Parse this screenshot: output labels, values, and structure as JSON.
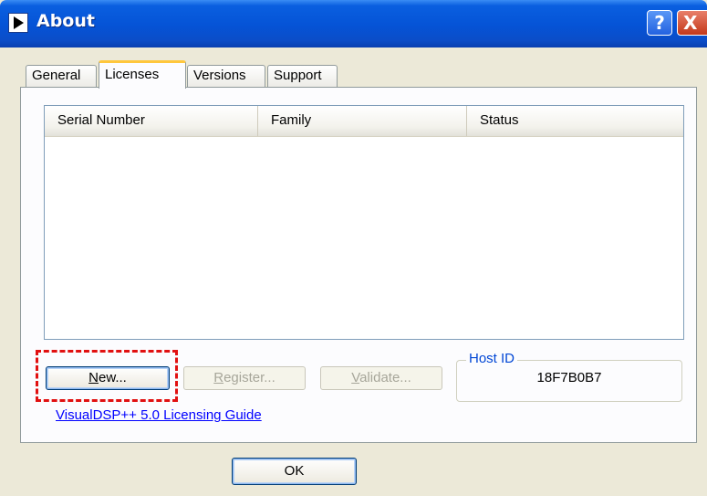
{
  "window": {
    "title": "About",
    "help_glyph": "?",
    "close_glyph": "X"
  },
  "tabs": [
    {
      "label": "General"
    },
    {
      "label": "Licenses",
      "selected": true
    },
    {
      "label": "Versions"
    },
    {
      "label": "Support"
    }
  ],
  "list": {
    "columns": [
      "Serial Number",
      "Family",
      "Status"
    ],
    "rows": []
  },
  "buttons": {
    "new": {
      "mnemonic": "N",
      "rest": "ew..."
    },
    "register": {
      "mnemonic": "R",
      "rest": "egister...",
      "enabled": false
    },
    "validate": {
      "mnemonic": "V",
      "rest": "alidate...",
      "enabled": false
    },
    "ok": "OK"
  },
  "host_id": {
    "label": "Host ID",
    "value": "18F7B0B7"
  },
  "link": {
    "text": "VisualDSP++ 5.0 Licensing Guide"
  },
  "colors": {
    "highlight": "#e11010",
    "titlebar": "#0553d6",
    "link": "#0000ff",
    "tab_accent": "#ffc73c"
  },
  "icons": [
    "app-play-icon",
    "help-icon",
    "close-icon"
  ]
}
